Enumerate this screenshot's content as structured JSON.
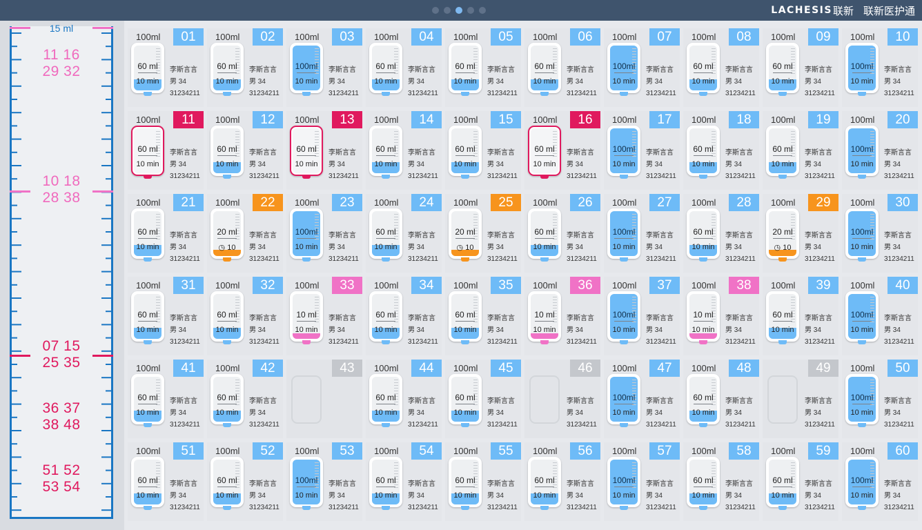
{
  "header": {
    "logo": "LACHESIS",
    "logo_cn": "联新",
    "app_name": "联新医护通",
    "pages": 5,
    "active_page": 3
  },
  "colors": {
    "blue": "#6ebbf7",
    "red": "#e0195e",
    "orange": "#f7941d",
    "pink": "#f072c6",
    "gray": "#c4c7cc"
  },
  "ruler": {
    "top_label": "15 ml",
    "groups": [
      {
        "line1": "11 16",
        "line2": "29 32",
        "color": "pink"
      },
      {
        "line1": "10 18",
        "line2": "28 38",
        "color": "pink"
      },
      {
        "line1": "07 15",
        "line2": "25 35",
        "color": "red"
      },
      {
        "line1": "36 37",
        "line2": "38 48",
        "color": "red"
      },
      {
        "line1": "51 52",
        "line2": "53 54",
        "color": "red"
      }
    ]
  },
  "beds": [
    {
      "num": "01",
      "cap": "100ml",
      "vol": "60 ml",
      "time": "10 min",
      "status": "blue",
      "fill": 0.25,
      "name": "李斯言言",
      "gender": "男",
      "age": "34",
      "id": "31234211"
    },
    {
      "num": "02",
      "cap": "100ml",
      "vol": "60 ml",
      "time": "10 min",
      "status": "blue",
      "fill": 0.25,
      "name": "李斯言言",
      "gender": "男",
      "age": "34",
      "id": "31234211"
    },
    {
      "num": "03",
      "cap": "100ml",
      "vol": "100ml",
      "time": "10 min",
      "status": "blue",
      "fill": 1.0,
      "name": "李斯言言",
      "gender": "男",
      "age": "34",
      "id": "31234211"
    },
    {
      "num": "04",
      "cap": "100ml",
      "vol": "60 ml",
      "time": "10 min",
      "status": "blue",
      "fill": 0.25,
      "name": "李斯言言",
      "gender": "男",
      "age": "34",
      "id": "31234211"
    },
    {
      "num": "05",
      "cap": "100ml",
      "vol": "60 ml",
      "time": "10 min",
      "status": "blue",
      "fill": 0.25,
      "name": "李斯言言",
      "gender": "男",
      "age": "34",
      "id": "31234211"
    },
    {
      "num": "06",
      "cap": "100ml",
      "vol": "60 ml",
      "time": "10 min",
      "status": "blue",
      "fill": 0.25,
      "name": "李斯言言",
      "gender": "男",
      "age": "34",
      "id": "31234211"
    },
    {
      "num": "07",
      "cap": "100ml",
      "vol": "100ml",
      "time": "10 min",
      "status": "blue",
      "fill": 1.0,
      "name": "李斯言言",
      "gender": "男",
      "age": "34",
      "id": "31234211"
    },
    {
      "num": "08",
      "cap": "100ml",
      "vol": "60 ml",
      "time": "10 min",
      "status": "blue",
      "fill": 0.25,
      "name": "李斯言言",
      "gender": "男",
      "age": "34",
      "id": "31234211"
    },
    {
      "num": "09",
      "cap": "100ml",
      "vol": "60 ml",
      "time": "10 min",
      "status": "blue",
      "fill": 0.25,
      "name": "李斯言言",
      "gender": "男",
      "age": "34",
      "id": "31234211"
    },
    {
      "num": "10",
      "cap": "100ml",
      "vol": "100ml",
      "time": "10 min",
      "status": "blue",
      "fill": 1.0,
      "name": "李斯言言",
      "gender": "男",
      "age": "34",
      "id": "31234211"
    },
    {
      "num": "11",
      "cap": "100ml",
      "vol": "60 ml",
      "time": "10 min",
      "status": "red",
      "fill": 0.0,
      "name": "李斯言言",
      "gender": "男",
      "age": "34",
      "id": "31234211"
    },
    {
      "num": "12",
      "cap": "100ml",
      "vol": "60 ml",
      "time": "10 min",
      "status": "blue",
      "fill": 0.25,
      "name": "李斯言言",
      "gender": "男",
      "age": "34",
      "id": "31234211"
    },
    {
      "num": "13",
      "cap": "100ml",
      "vol": "60 ml",
      "time": "10 min",
      "status": "red",
      "fill": 0.0,
      "name": "李斯言言",
      "gender": "男",
      "age": "34",
      "id": "31234211"
    },
    {
      "num": "14",
      "cap": "100ml",
      "vol": "60 ml",
      "time": "10 min",
      "status": "blue",
      "fill": 0.25,
      "name": "李斯言言",
      "gender": "男",
      "age": "34",
      "id": "31234211"
    },
    {
      "num": "15",
      "cap": "100ml",
      "vol": "60 ml",
      "time": "10 min",
      "status": "blue",
      "fill": 0.25,
      "name": "李斯言言",
      "gender": "男",
      "age": "34",
      "id": "31234211"
    },
    {
      "num": "16",
      "cap": "100ml",
      "vol": "60 ml",
      "time": "10 min",
      "status": "red",
      "fill": 0.0,
      "name": "李斯言言",
      "gender": "男",
      "age": "34",
      "id": "31234211"
    },
    {
      "num": "17",
      "cap": "100ml",
      "vol": "100ml",
      "time": "10 min",
      "status": "blue",
      "fill": 1.0,
      "name": "李斯言言",
      "gender": "男",
      "age": "34",
      "id": "31234211"
    },
    {
      "num": "18",
      "cap": "100ml",
      "vol": "60 ml",
      "time": "10 min",
      "status": "blue",
      "fill": 0.25,
      "name": "李斯言言",
      "gender": "男",
      "age": "34",
      "id": "31234211"
    },
    {
      "num": "19",
      "cap": "100ml",
      "vol": "60 ml",
      "time": "10 min",
      "status": "blue",
      "fill": 0.25,
      "name": "李斯言言",
      "gender": "男",
      "age": "34",
      "id": "31234211"
    },
    {
      "num": "20",
      "cap": "100ml",
      "vol": "100ml",
      "time": "10 min",
      "status": "blue",
      "fill": 1.0,
      "name": "李斯言言",
      "gender": "男",
      "age": "34",
      "id": "31234211"
    },
    {
      "num": "21",
      "cap": "100ml",
      "vol": "60 ml",
      "time": "10 min",
      "status": "blue",
      "fill": 0.25,
      "name": "李斯言言",
      "gender": "男",
      "age": "34",
      "id": "31234211"
    },
    {
      "num": "22",
      "cap": "100ml",
      "vol": "20 ml",
      "time": "10",
      "status": "orange",
      "fill": 0.14,
      "clock": true,
      "name": "李斯言言",
      "gender": "男",
      "age": "34",
      "id": "31234211"
    },
    {
      "num": "23",
      "cap": "100ml",
      "vol": "100ml",
      "time": "10 min",
      "status": "blue",
      "fill": 1.0,
      "name": "李斯言言",
      "gender": "男",
      "age": "34",
      "id": "31234211"
    },
    {
      "num": "24",
      "cap": "100ml",
      "vol": "60 ml",
      "time": "10 min",
      "status": "blue",
      "fill": 0.25,
      "name": "李斯言言",
      "gender": "男",
      "age": "34",
      "id": "31234211"
    },
    {
      "num": "25",
      "cap": "100ml",
      "vol": "20 ml",
      "time": "10",
      "status": "orange",
      "fill": 0.14,
      "clock": true,
      "name": "李斯言言",
      "gender": "男",
      "age": "34",
      "id": "31234211"
    },
    {
      "num": "26",
      "cap": "100ml",
      "vol": "60 ml",
      "time": "10 min",
      "status": "blue",
      "fill": 0.25,
      "name": "李斯言言",
      "gender": "男",
      "age": "34",
      "id": "31234211"
    },
    {
      "num": "27",
      "cap": "100ml",
      "vol": "100ml",
      "time": "10 min",
      "status": "blue",
      "fill": 1.0,
      "name": "李斯言言",
      "gender": "男",
      "age": "34",
      "id": "31234211"
    },
    {
      "num": "28",
      "cap": "100ml",
      "vol": "60 ml",
      "time": "10 min",
      "status": "blue",
      "fill": 0.25,
      "name": "李斯言言",
      "gender": "男",
      "age": "34",
      "id": "31234211"
    },
    {
      "num": "29",
      "cap": "100ml",
      "vol": "20 ml",
      "time": "10",
      "status": "orange",
      "fill": 0.14,
      "clock": true,
      "name": "李斯言言",
      "gender": "男",
      "age": "34",
      "id": "31234211"
    },
    {
      "num": "30",
      "cap": "100ml",
      "vol": "100ml",
      "time": "10 min",
      "status": "blue",
      "fill": 1.0,
      "name": "李斯言言",
      "gender": "男",
      "age": "34",
      "id": "31234211"
    },
    {
      "num": "31",
      "cap": "100ml",
      "vol": "60 ml",
      "time": "10 min",
      "status": "blue",
      "fill": 0.25,
      "name": "李斯言言",
      "gender": "男",
      "age": "34",
      "id": "31234211"
    },
    {
      "num": "32",
      "cap": "100ml",
      "vol": "60 ml",
      "time": "10 min",
      "status": "blue",
      "fill": 0.25,
      "name": "李斯言言",
      "gender": "男",
      "age": "34",
      "id": "31234211"
    },
    {
      "num": "33",
      "cap": "100ml",
      "vol": "10 ml",
      "time": "10 min",
      "status": "pink",
      "fill": 0.12,
      "name": "李斯言言",
      "gender": "男",
      "age": "34",
      "id": "31234211"
    },
    {
      "num": "34",
      "cap": "100ml",
      "vol": "60 ml",
      "time": "10 min",
      "status": "blue",
      "fill": 0.25,
      "name": "李斯言言",
      "gender": "男",
      "age": "34",
      "id": "31234211"
    },
    {
      "num": "35",
      "cap": "100ml",
      "vol": "60 ml",
      "time": "10 min",
      "status": "blue",
      "fill": 0.25,
      "name": "李斯言言",
      "gender": "男",
      "age": "34",
      "id": "31234211"
    },
    {
      "num": "36",
      "cap": "100ml",
      "vol": "10 ml",
      "time": "10 min",
      "status": "pink",
      "fill": 0.12,
      "name": "李斯言言",
      "gender": "男",
      "age": "34",
      "id": "31234211"
    },
    {
      "num": "37",
      "cap": "100ml",
      "vol": "100ml",
      "time": "10 min",
      "status": "blue",
      "fill": 1.0,
      "name": "李斯言言",
      "gender": "男",
      "age": "34",
      "id": "31234211"
    },
    {
      "num": "38",
      "cap": "100ml",
      "vol": "10 ml",
      "time": "10 min",
      "status": "pink",
      "fill": 0.12,
      "name": "李斯言言",
      "gender": "男",
      "age": "34",
      "id": "31234211"
    },
    {
      "num": "39",
      "cap": "100ml",
      "vol": "60 ml",
      "time": "10 min",
      "status": "blue",
      "fill": 0.25,
      "name": "李斯言言",
      "gender": "男",
      "age": "34",
      "id": "31234211"
    },
    {
      "num": "40",
      "cap": "100ml",
      "vol": "100ml",
      "time": "10 min",
      "status": "blue",
      "fill": 1.0,
      "name": "李斯言言",
      "gender": "男",
      "age": "34",
      "id": "31234211"
    },
    {
      "num": "41",
      "cap": "100ml",
      "vol": "60 ml",
      "time": "10 min",
      "status": "blue",
      "fill": 0.25,
      "name": "李斯言言",
      "gender": "男",
      "age": "34",
      "id": "31234211"
    },
    {
      "num": "42",
      "cap": "100ml",
      "vol": "60 ml",
      "time": "10 min",
      "status": "blue",
      "fill": 0.25,
      "name": "李斯言言",
      "gender": "男",
      "age": "34",
      "id": "31234211"
    },
    {
      "num": "43",
      "status": "empty"
    },
    {
      "num": "44",
      "cap": "100ml",
      "vol": "60 ml",
      "time": "10 min",
      "status": "blue",
      "fill": 0.25,
      "name": "李斯言言",
      "gender": "男",
      "age": "34",
      "id": "31234211"
    },
    {
      "num": "45",
      "cap": "100ml",
      "vol": "60 ml",
      "time": "10 min",
      "status": "blue",
      "fill": 0.25,
      "name": "李斯言言",
      "gender": "男",
      "age": "34",
      "id": "31234211"
    },
    {
      "num": "46",
      "status": "empty",
      "name": "李斯言言",
      "gender": "男",
      "age": "34",
      "id": "31234211"
    },
    {
      "num": "47",
      "cap": "100ml",
      "vol": "100ml",
      "time": "10 min",
      "status": "blue",
      "fill": 1.0,
      "name": "李斯言言",
      "gender": "男",
      "age": "34",
      "id": "31234211"
    },
    {
      "num": "48",
      "cap": "100ml",
      "vol": "60 ml",
      "time": "10 min",
      "status": "blue",
      "fill": 0.25,
      "name": "李斯言言",
      "gender": "男",
      "age": "34",
      "id": "31234211"
    },
    {
      "num": "49",
      "status": "empty",
      "name": "李斯言言",
      "gender": "男",
      "age": "34",
      "id": "31234211"
    },
    {
      "num": "50",
      "cap": "100ml",
      "vol": "100ml",
      "time": "10 min",
      "status": "blue",
      "fill": 1.0,
      "name": "李斯言言",
      "gender": "男",
      "age": "34",
      "id": "31234211"
    },
    {
      "num": "51",
      "cap": "100ml",
      "vol": "60 ml",
      "time": "10 min",
      "status": "blue",
      "fill": 0.25,
      "name": "李斯言言",
      "gender": "男",
      "age": "34",
      "id": "31234211"
    },
    {
      "num": "52",
      "cap": "100ml",
      "vol": "60 ml",
      "time": "10 min",
      "status": "blue",
      "fill": 0.25,
      "name": "李斯言言",
      "gender": "男",
      "age": "34",
      "id": "31234211"
    },
    {
      "num": "53",
      "cap": "100ml",
      "vol": "100ml",
      "time": "10 min",
      "status": "blue",
      "fill": 1.0,
      "name": "李斯言言",
      "gender": "男",
      "age": "34",
      "id": "31234211"
    },
    {
      "num": "54",
      "cap": "100ml",
      "vol": "60 ml",
      "time": "10 min",
      "status": "blue",
      "fill": 0.25,
      "name": "李斯言言",
      "gender": "男",
      "age": "34",
      "id": "31234211"
    },
    {
      "num": "55",
      "cap": "100ml",
      "vol": "60 ml",
      "time": "10 min",
      "status": "blue",
      "fill": 0.25,
      "name": "李斯言言",
      "gender": "男",
      "age": "34",
      "id": "31234211"
    },
    {
      "num": "56",
      "cap": "100ml",
      "vol": "60 ml",
      "time": "10 min",
      "status": "blue",
      "fill": 0.25,
      "name": "李斯言言",
      "gender": "男",
      "age": "34",
      "id": "31234211"
    },
    {
      "num": "57",
      "cap": "100ml",
      "vol": "100ml",
      "time": "10 min",
      "status": "blue",
      "fill": 1.0,
      "name": "李斯言言",
      "gender": "男",
      "age": "34",
      "id": "31234211"
    },
    {
      "num": "58",
      "cap": "100ml",
      "vol": "60 ml",
      "time": "10 min",
      "status": "blue",
      "fill": 0.25,
      "name": "李斯言言",
      "gender": "男",
      "age": "34",
      "id": "31234211"
    },
    {
      "num": "59",
      "cap": "100ml",
      "vol": "60 ml",
      "time": "10 min",
      "status": "blue",
      "fill": 0.25,
      "name": "李斯言言",
      "gender": "男",
      "age": "34",
      "id": "31234211"
    },
    {
      "num": "60",
      "cap": "100ml",
      "vol": "100ml",
      "time": "10 min",
      "status": "blue",
      "fill": 1.0,
      "name": "李斯言言",
      "gender": "男",
      "age": "34",
      "id": "31234211"
    }
  ]
}
